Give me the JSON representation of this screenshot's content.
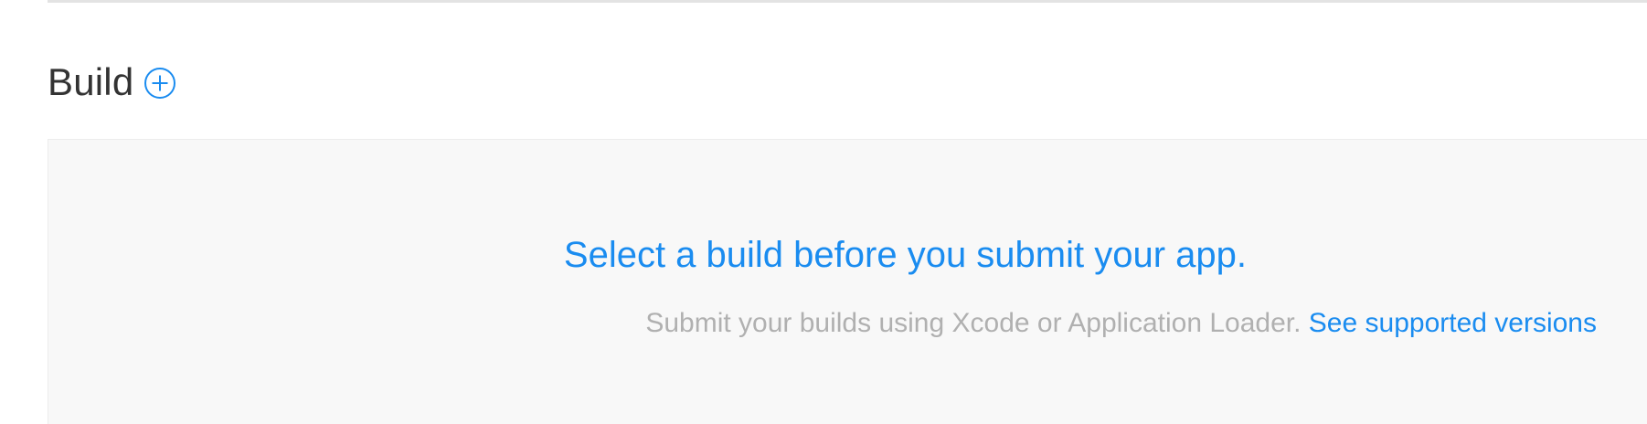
{
  "section": {
    "title": "Build",
    "add_icon": "plus-circle-icon"
  },
  "empty_state": {
    "title": "Select a build before you submit your app.",
    "subtext": "Submit your builds using Xcode or Application Loader.",
    "link_label": "See supported versions"
  },
  "colors": {
    "accent": "#1a8cf0",
    "title_text": "#333333",
    "muted_text": "#b0b0b0",
    "panel_bg": "#f8f8f8",
    "divider": "#e3e3e3"
  }
}
